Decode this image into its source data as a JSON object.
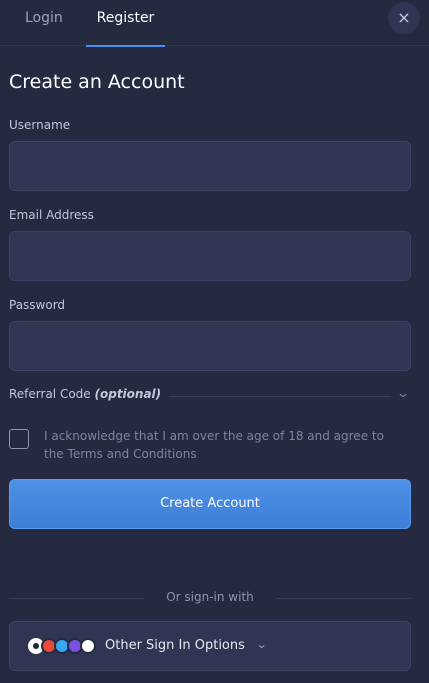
{
  "tabs": {
    "login": "Login",
    "register": "Register",
    "active": "Register"
  },
  "close_icon": "×",
  "title": "Create an Account",
  "fields": {
    "username": {
      "label": "Username",
      "value": "",
      "placeholder": ""
    },
    "email": {
      "label": "Email Address",
      "value": "",
      "placeholder": ""
    },
    "password": {
      "label": "Password",
      "value": "",
      "placeholder": ""
    }
  },
  "referral": {
    "label": "Referral Code",
    "optional": "(optional)",
    "chevron": "⌄",
    "expanded": false
  },
  "acknowledge": {
    "line1": "I acknowledge that I am over the age of 18 and agree to",
    "prefix": "the",
    "link": "Terms and Conditions",
    "checked": false
  },
  "create_button": "Create Account",
  "divider_text": "Or sign-in with",
  "other_options": {
    "label": "Other Sign In Options",
    "chevron": "⌄",
    "icons": [
      "steam-icon",
      "provider-red-icon",
      "provider-blue-icon",
      "provider-purple-icon",
      "provider-white-icon"
    ]
  },
  "colors": {
    "background": "#252a41",
    "input_bg": "#2f3552",
    "accent": "#4a8fe7",
    "primary_button": "#4389e0"
  }
}
